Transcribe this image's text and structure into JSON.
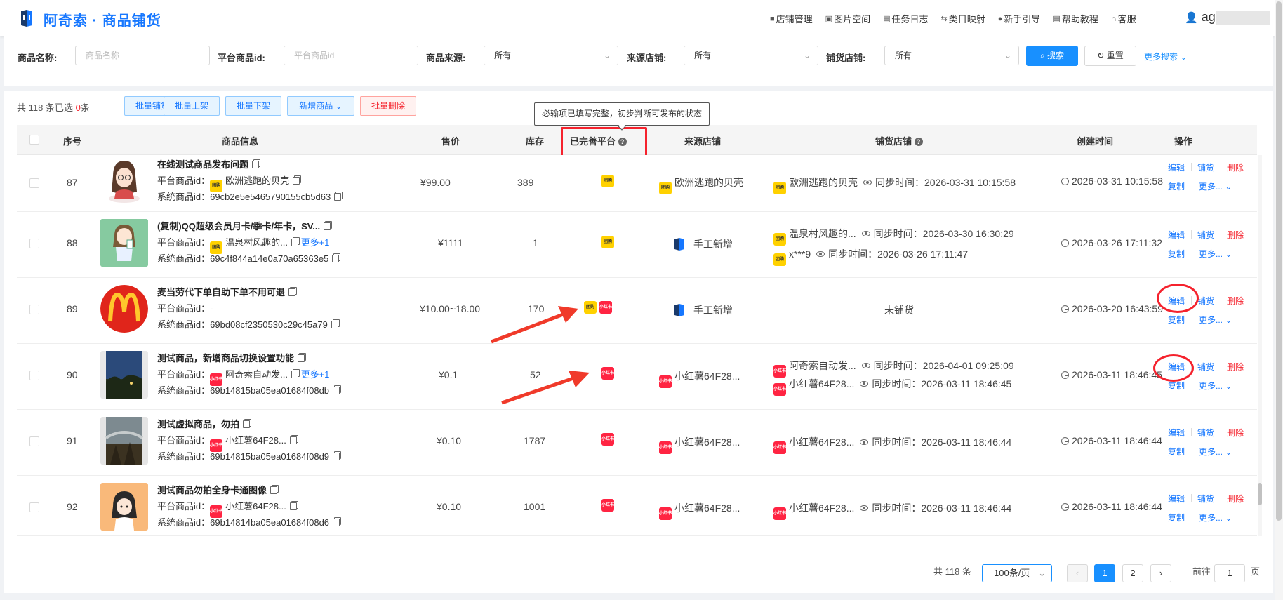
{
  "app": {
    "title": "阿奇索 · 商品铺货"
  },
  "topnav": [
    "店铺管理",
    "图片空间",
    "任务日志",
    "类目映射",
    "新手引导",
    "帮助教程",
    "客服"
  ],
  "user": {
    "name": "ag"
  },
  "filters": {
    "name_label": "商品名称:",
    "name_placeholder": "商品名称",
    "pid_label": "平台商品id:",
    "pid_placeholder": "平台商品id",
    "source_label": "商品来源:",
    "source_value": "所有",
    "shop_label": "来源店铺:",
    "shop_value": "所有",
    "target_label": "铺货店铺:",
    "target_value": "所有",
    "search": "搜索",
    "reset": "重置",
    "more": "更多搜索"
  },
  "toolbar": {
    "summary_pre": "共 118 条已选",
    "selected": "0",
    "summary_post": "条",
    "buttons": [
      "批量铺货",
      "批量上架",
      "批量下架",
      "新增商品",
      "批量删除"
    ]
  },
  "tooltip": "必输项已填写完整，初步判断可发布的状态",
  "columns": [
    "序号",
    "商品信息",
    "售价",
    "库存",
    "已完善平台",
    "来源店铺",
    "铺货店铺",
    "创建时间",
    "操作"
  ],
  "labels": {
    "platform_id": "平台商品id：",
    "system_id": "系统商品id：",
    "sync": "同步时间：",
    "more_n": "更多+1",
    "edit": "编辑",
    "distribute": "铺货",
    "delete": "删除",
    "copy": "复制",
    "more": "更多..."
  },
  "platform_icons": {
    "meituan": "团购",
    "xiaohongshu": "小红书"
  },
  "rows": [
    {
      "no": "87",
      "title": "在线测试商品发布问题",
      "platform_text": "欧洲逃跑的贝壳",
      "system_id": "69cb2e5e5465790155cb5d63",
      "price": "¥99.00",
      "stock": "389",
      "source": "欧洲逃跑的贝壳",
      "dist": [
        {
          "shop": "欧洲逃跑的贝壳",
          "time": "2026-03-31 10:15:58"
        }
      ],
      "created": "2026-03-31 10:15:58"
    },
    {
      "no": "88",
      "title": "(复制)QQ超级会员月卡/季卡/年卡，SV...",
      "platform_text": "温泉村风趣的...",
      "system_id": "69c4f844a14e0a70a65363e5",
      "price": "¥1111",
      "stock": "1",
      "source": "手工新增",
      "dist": [
        {
          "shop": "温泉村风趣的...",
          "time": "2026-03-30 16:30:29"
        },
        {
          "shop": "x***9",
          "time": "2026-03-26 17:11:47"
        }
      ],
      "created": "2026-03-26 17:11:32"
    },
    {
      "no": "89",
      "title": "麦当劳代下单自助下单不用可退",
      "platform_text": "-",
      "system_id": "69bd08cf2350530c29c45a79",
      "price": "¥10.00~18.00",
      "stock": "170",
      "source": "手工新增",
      "dist_none": "未铺货",
      "created": "2026-03-20 16:43:59"
    },
    {
      "no": "90",
      "title": "测试商品，新增商品切换设置功能",
      "platform_text": "阿奇索自动发...",
      "system_id": "69b14815ba05ea01684f08db",
      "price": "¥0.1",
      "stock": "52",
      "source": "小红薯64F28...",
      "dist": [
        {
          "shop": "阿奇索自动发...",
          "time": "2026-04-01 09:25:09"
        },
        {
          "shop": "小红薯64F28...",
          "time": "2026-03-11 18:46:45"
        }
      ],
      "created": "2026-03-11 18:46:45"
    },
    {
      "no": "91",
      "title": "测试虚拟商品，勿拍",
      "platform_text": "小红薯64F28...",
      "system_id": "69b14815ba05ea01684f08d9",
      "price": "¥0.10",
      "stock": "1787",
      "source": "小红薯64F28...",
      "dist": [
        {
          "shop": "小红薯64F28...",
          "time": "2026-03-11 18:46:44"
        }
      ],
      "created": "2026-03-11 18:46:44"
    },
    {
      "no": "92",
      "title": "测试商品勿拍全身卡通图像",
      "platform_text": "小红薯64F28...",
      "system_id": "69b14814ba05ea01684f08d6",
      "price": "¥0.10",
      "stock": "1001",
      "source": "小红薯64F28...",
      "dist": [
        {
          "shop": "小红薯64F28...",
          "time": "2026-03-11 18:46:44"
        }
      ],
      "created": "2026-03-11 18:46:44"
    }
  ],
  "pagination": {
    "total": "共 118 条",
    "page_size": "100条/页",
    "pages": [
      "1",
      "2"
    ],
    "goto": "前往",
    "goto_value": "1",
    "page_unit": "页"
  }
}
